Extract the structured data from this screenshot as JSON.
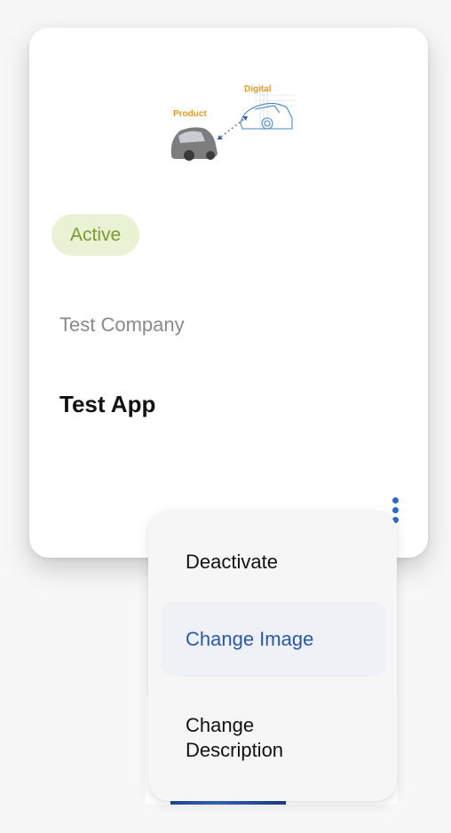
{
  "card": {
    "thumbnail": {
      "label_product": "Product",
      "label_digital": "Digital"
    },
    "status_badge": "Active",
    "company": "Test Company",
    "app_name": "Test App"
  },
  "menu": {
    "items": [
      {
        "label": "Deactivate",
        "highlighted": false
      },
      {
        "label": "Change Image",
        "highlighted": true
      },
      {
        "label": "Change\nDescription",
        "highlighted": false
      }
    ]
  },
  "colors": {
    "accent": "#2e6ac7",
    "badge_bg": "#eaf2d6",
    "badge_text": "#7a9a2e",
    "highlight_bg": "#eef1f6",
    "highlight_text": "#2a58a8"
  }
}
